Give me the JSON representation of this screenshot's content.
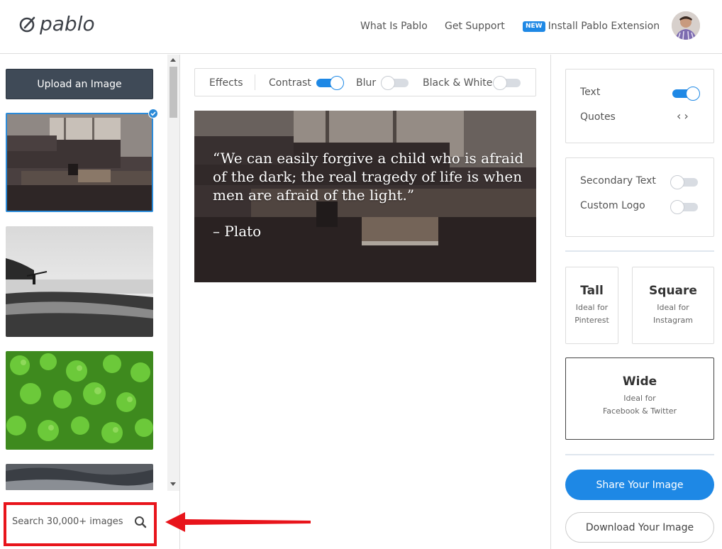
{
  "header": {
    "logo_text": "pablo",
    "nav": {
      "what_is": "What Is Pablo",
      "support": "Get Support",
      "new_badge": "NEW",
      "install": "Install Pablo Extension"
    }
  },
  "sidebar": {
    "upload_label": "Upload an Image",
    "search_placeholder": "Search 30,000+ images",
    "thumbnails": [
      {
        "subject": "living room with coffee table",
        "selected": true
      },
      {
        "subject": "black and white beach with surfer",
        "selected": false
      },
      {
        "subject": "green clover leaves with water drops",
        "selected": false
      },
      {
        "subject": "cloudy sky",
        "selected": false
      }
    ]
  },
  "toolbar": {
    "effects": "Effects",
    "contrast": "Contrast",
    "contrast_on": true,
    "blur": "Blur",
    "blur_on": false,
    "bw": "Black & White",
    "bw_on": false
  },
  "preview": {
    "quote": "“We can easily forgive a child who is afraid of the dark; the real tragedy of life is when men are afraid of the light.”",
    "author": "– Plato"
  },
  "right_panel": {
    "text_label": "Text",
    "text_on": true,
    "quotes_label": "Quotes",
    "secondary_label": "Secondary Text",
    "secondary_on": false,
    "logo_label": "Custom Logo",
    "logo_on": false,
    "sizes": {
      "tall_title": "Tall",
      "tall_desc_1": "Ideal for",
      "tall_desc_2": "Pinterest",
      "square_title": "Square",
      "square_desc_1": "Ideal for",
      "square_desc_2": "Instagram",
      "wide_title": "Wide",
      "wide_desc_1": "Ideal for",
      "wide_desc_2": "Facebook & Twitter"
    },
    "share_label": "Share Your Image",
    "download_label": "Download Your Image"
  },
  "colors": {
    "accent": "#1e88e5",
    "upload_button": "#3f4a57",
    "highlight_red": "#e8141b"
  }
}
